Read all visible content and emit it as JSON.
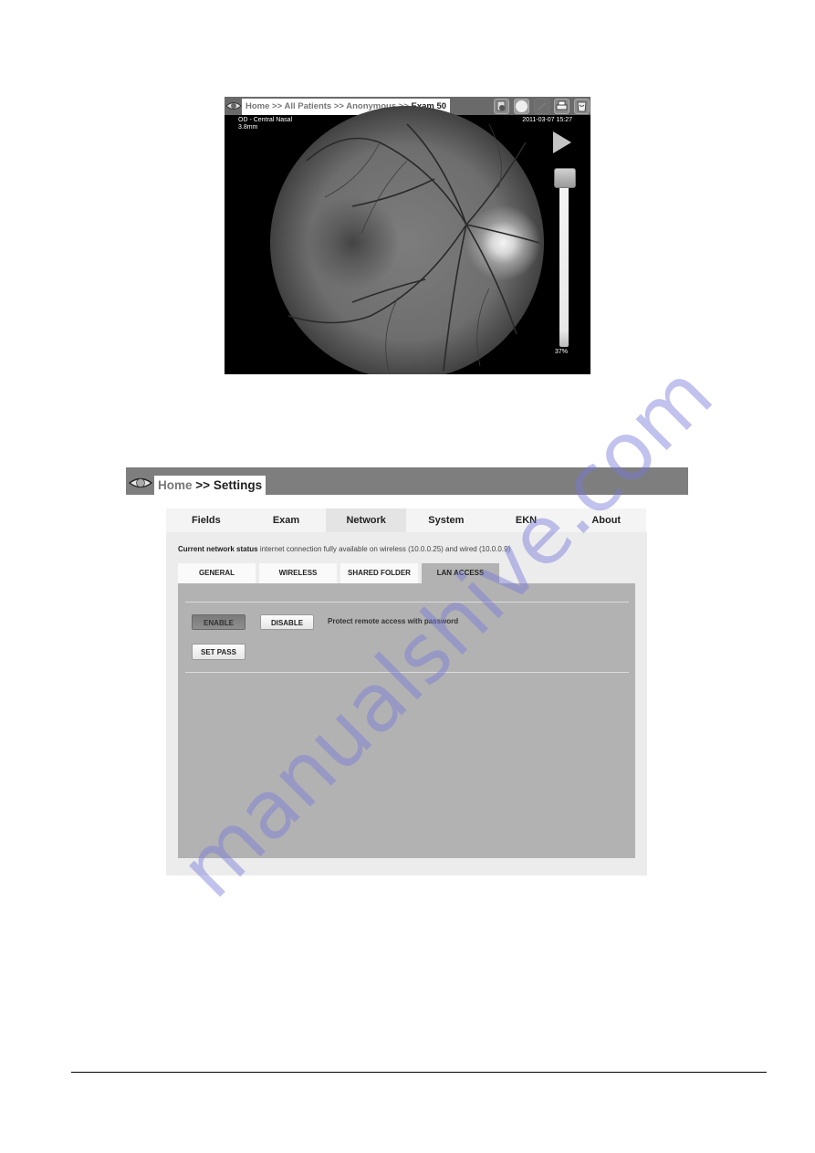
{
  "viewer": {
    "breadcrumb": {
      "items": [
        "Home",
        "All Patients",
        "Anonymous"
      ],
      "separator": ">>",
      "current": "Exam 50"
    },
    "toolbar_icons": [
      "export-icon",
      "circle-icon",
      "disabled-icon",
      "print-icon",
      "trash-icon"
    ],
    "eye_label": "OD - Central Nasal",
    "distance": "3.8mm",
    "timestamp": "2011-03-07 15:27",
    "slider": {
      "value_label": "37%",
      "value": 0.37
    }
  },
  "settings": {
    "breadcrumb": {
      "home": "Home",
      "separator": ">>",
      "current": "Settings"
    },
    "tabs": [
      {
        "label": "Fields",
        "active": false
      },
      {
        "label": "Exam",
        "active": false
      },
      {
        "label": "Network",
        "active": true
      },
      {
        "label": "System",
        "active": false
      },
      {
        "label": "EKN",
        "active": false
      },
      {
        "label": "About",
        "active": false
      }
    ],
    "status_label": "Current network status",
    "status_text": "internet connection fully available on wireless (10.0.0.25) and wired (10.0.0.9)",
    "subtabs": [
      {
        "label": "GENERAL",
        "active": false
      },
      {
        "label": "WIRELESS",
        "active": false
      },
      {
        "label": "SHARED FOLDER",
        "active": false
      },
      {
        "label": "LAN ACCESS",
        "active": true
      }
    ],
    "lan_access": {
      "enable_label": "ENABLE",
      "disable_label": "DISABLE",
      "protect_label": "Protect remote access with password",
      "set_pass_label": "SET PASS"
    }
  },
  "watermark": "manualshive.com"
}
